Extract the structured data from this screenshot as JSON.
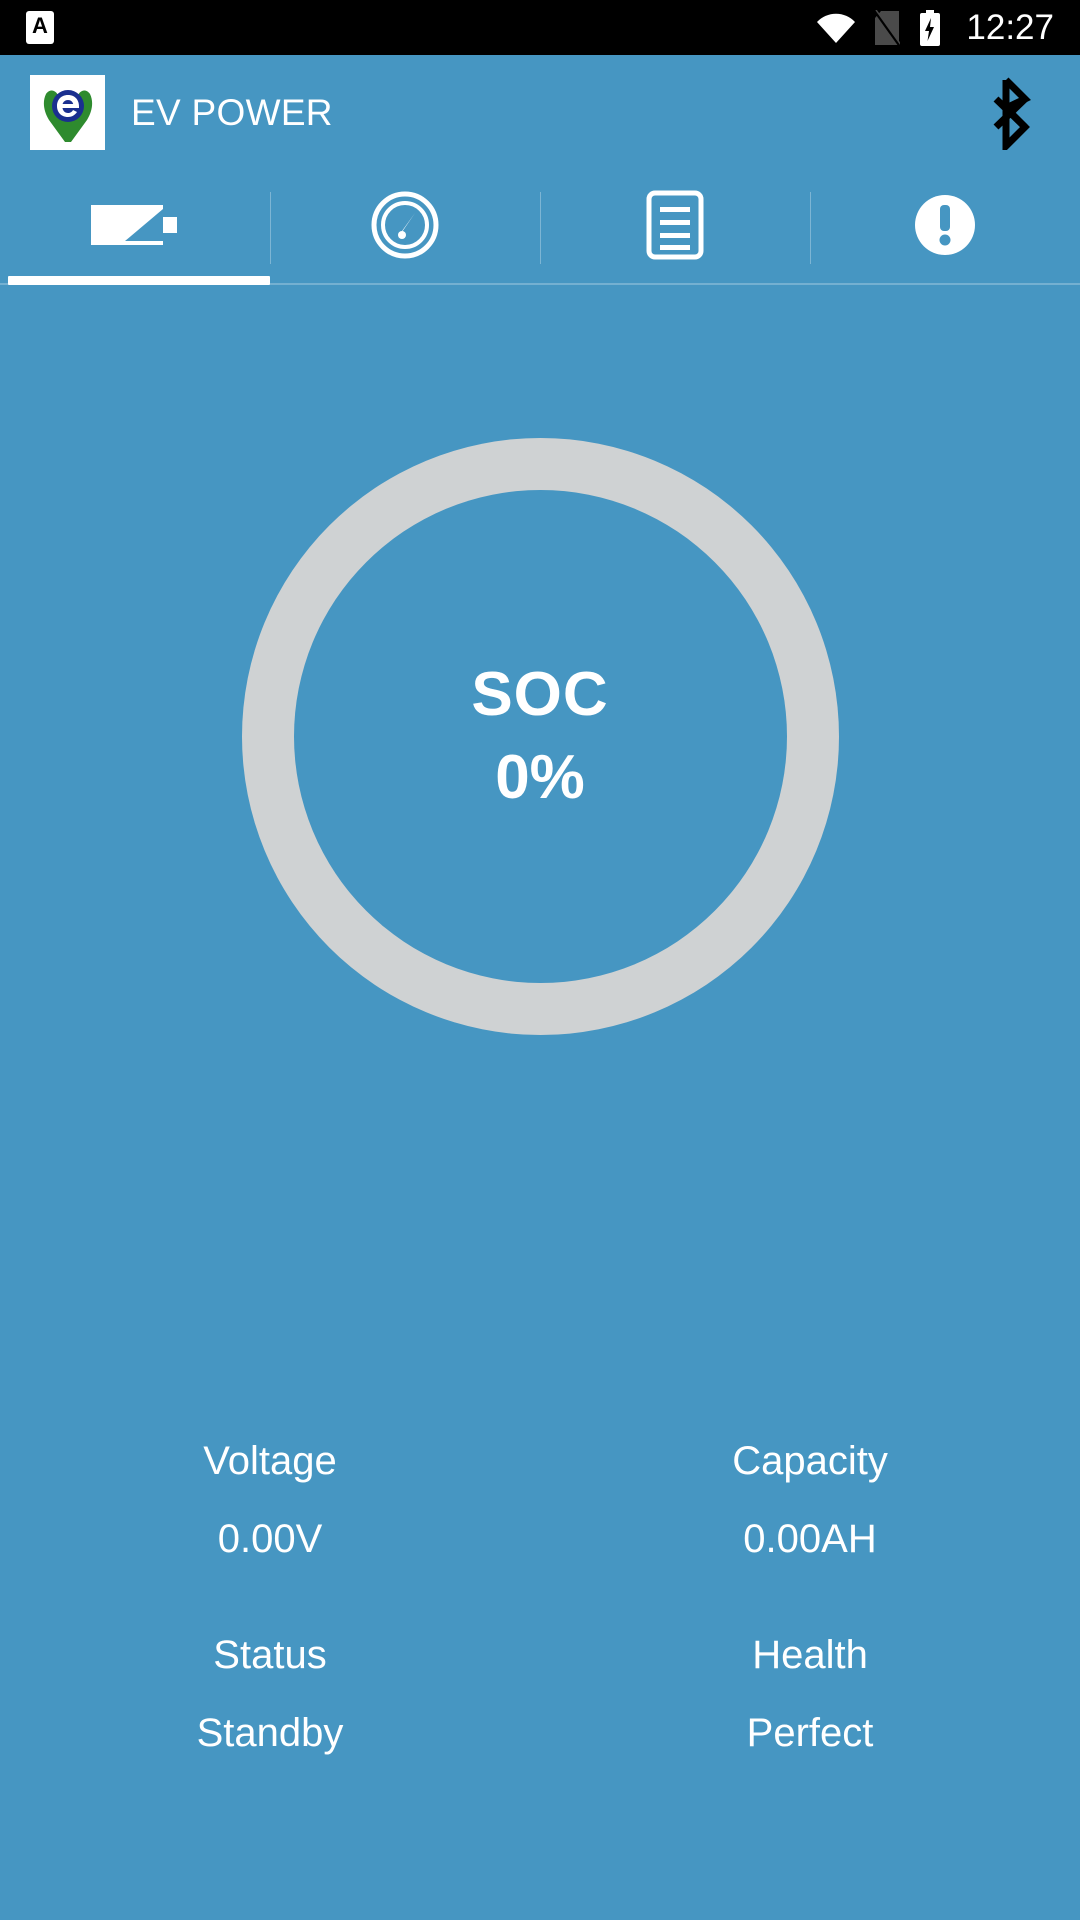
{
  "theme": {
    "accent": "#4696c2",
    "statusbar_bg": "#000000",
    "ring_track": "#cfd2d3",
    "text_on_accent": "#ffffff",
    "bluetooth_icon_color": "#000000",
    "logo_green": "#2e8b2e",
    "logo_blue": "#1a2f8f"
  },
  "statusbar": {
    "time": "12:27",
    "icons": [
      {
        "name": "app-notification-icon",
        "glyph": "A"
      },
      {
        "name": "wifi-icon"
      },
      {
        "name": "no-sim-icon"
      },
      {
        "name": "battery-charging-icon"
      }
    ]
  },
  "appbar": {
    "logo_name": "ev-power-logo",
    "title": "EV POWER",
    "bluetooth_icon": "bluetooth-icon"
  },
  "tabs": [
    {
      "key": "battery",
      "icon": "battery-icon",
      "label": "Battery",
      "active": true
    },
    {
      "key": "gauge",
      "icon": "gauge-icon",
      "label": "Gauge",
      "active": false
    },
    {
      "key": "cells",
      "icon": "list-icon",
      "label": "Cells",
      "active": false
    },
    {
      "key": "alarms",
      "icon": "alert-icon",
      "label": "Alarms",
      "active": false
    }
  ],
  "gauge": {
    "label": "SOC",
    "value": "0%",
    "percent": 0
  },
  "stats": [
    [
      {
        "label": "Voltage",
        "value": "0.00V"
      },
      {
        "label": "Capacity",
        "value": "0.00AH"
      }
    ],
    [
      {
        "label": "Status",
        "value": "Standby"
      },
      {
        "label": "Health",
        "value": "Perfect"
      }
    ]
  ]
}
